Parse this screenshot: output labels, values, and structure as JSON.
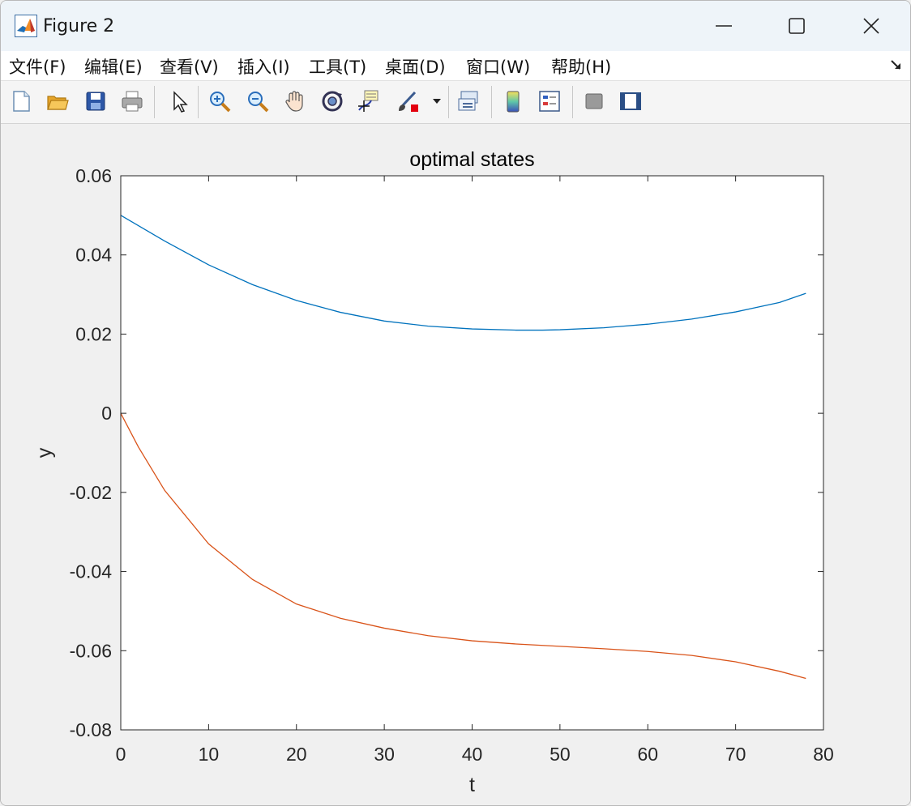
{
  "window": {
    "title": "Figure 2",
    "app_icon": "matlab-icon",
    "controls": [
      "minimize-icon",
      "maximize-icon",
      "close-icon"
    ]
  },
  "menu": {
    "items": [
      {
        "label": "文件(F)"
      },
      {
        "label": "编辑(E)"
      },
      {
        "label": "查看(V)"
      },
      {
        "label": "插入(I)"
      },
      {
        "label": "工具(T)"
      },
      {
        "label": "桌面(D)"
      },
      {
        "label": "窗口(W)"
      },
      {
        "label": "帮助(H)"
      }
    ]
  },
  "toolbar": {
    "tools": [
      "new-figure-icon",
      "open-file-icon",
      "save-icon",
      "print-icon",
      "select-arrow-icon",
      "zoom-in-icon",
      "zoom-out-icon",
      "pan-hand-icon",
      "rotate-3d-icon",
      "data-cursor-icon",
      "brush-icon",
      "brush-dropdown-icon",
      "link-plot-icon",
      "colorbar-icon",
      "legend-icon",
      "hide-plot-tools-icon",
      "show-plot-tools-icon"
    ]
  },
  "chart_data": {
    "type": "line",
    "title": "optimal states",
    "xlabel": "t",
    "ylabel": "y",
    "xlim": [
      0,
      80
    ],
    "ylim": [
      -0.08,
      0.06
    ],
    "xticks": [
      "0",
      "10",
      "20",
      "30",
      "40",
      "50",
      "60",
      "70",
      "80"
    ],
    "yticks": [
      "-0.08",
      "-0.06",
      "-0.04",
      "-0.02",
      "0",
      "0.02",
      "0.04",
      "0.06"
    ],
    "grid": false,
    "series": [
      {
        "color": "#0072bd",
        "x": [
          0,
          5,
          10,
          15,
          20,
          25,
          30,
          35,
          40,
          45,
          48,
          50,
          55,
          60,
          65,
          70,
          75,
          78
        ],
        "y": [
          0.05,
          0.0435,
          0.0375,
          0.0325,
          0.0285,
          0.0255,
          0.0233,
          0.022,
          0.0213,
          0.021,
          0.021,
          0.0211,
          0.0216,
          0.0225,
          0.0238,
          0.0256,
          0.028,
          0.0303
        ]
      },
      {
        "color": "#d95319",
        "x": [
          0,
          2,
          5,
          10,
          15,
          20,
          25,
          30,
          35,
          40,
          45,
          50,
          55,
          60,
          65,
          70,
          75,
          78
        ],
        "y": [
          0.0,
          -0.0085,
          -0.0195,
          -0.033,
          -0.042,
          -0.0482,
          -0.0518,
          -0.0543,
          -0.0562,
          -0.0575,
          -0.0583,
          -0.0589,
          -0.0595,
          -0.0602,
          -0.0612,
          -0.0628,
          -0.0652,
          -0.067
        ]
      }
    ]
  }
}
